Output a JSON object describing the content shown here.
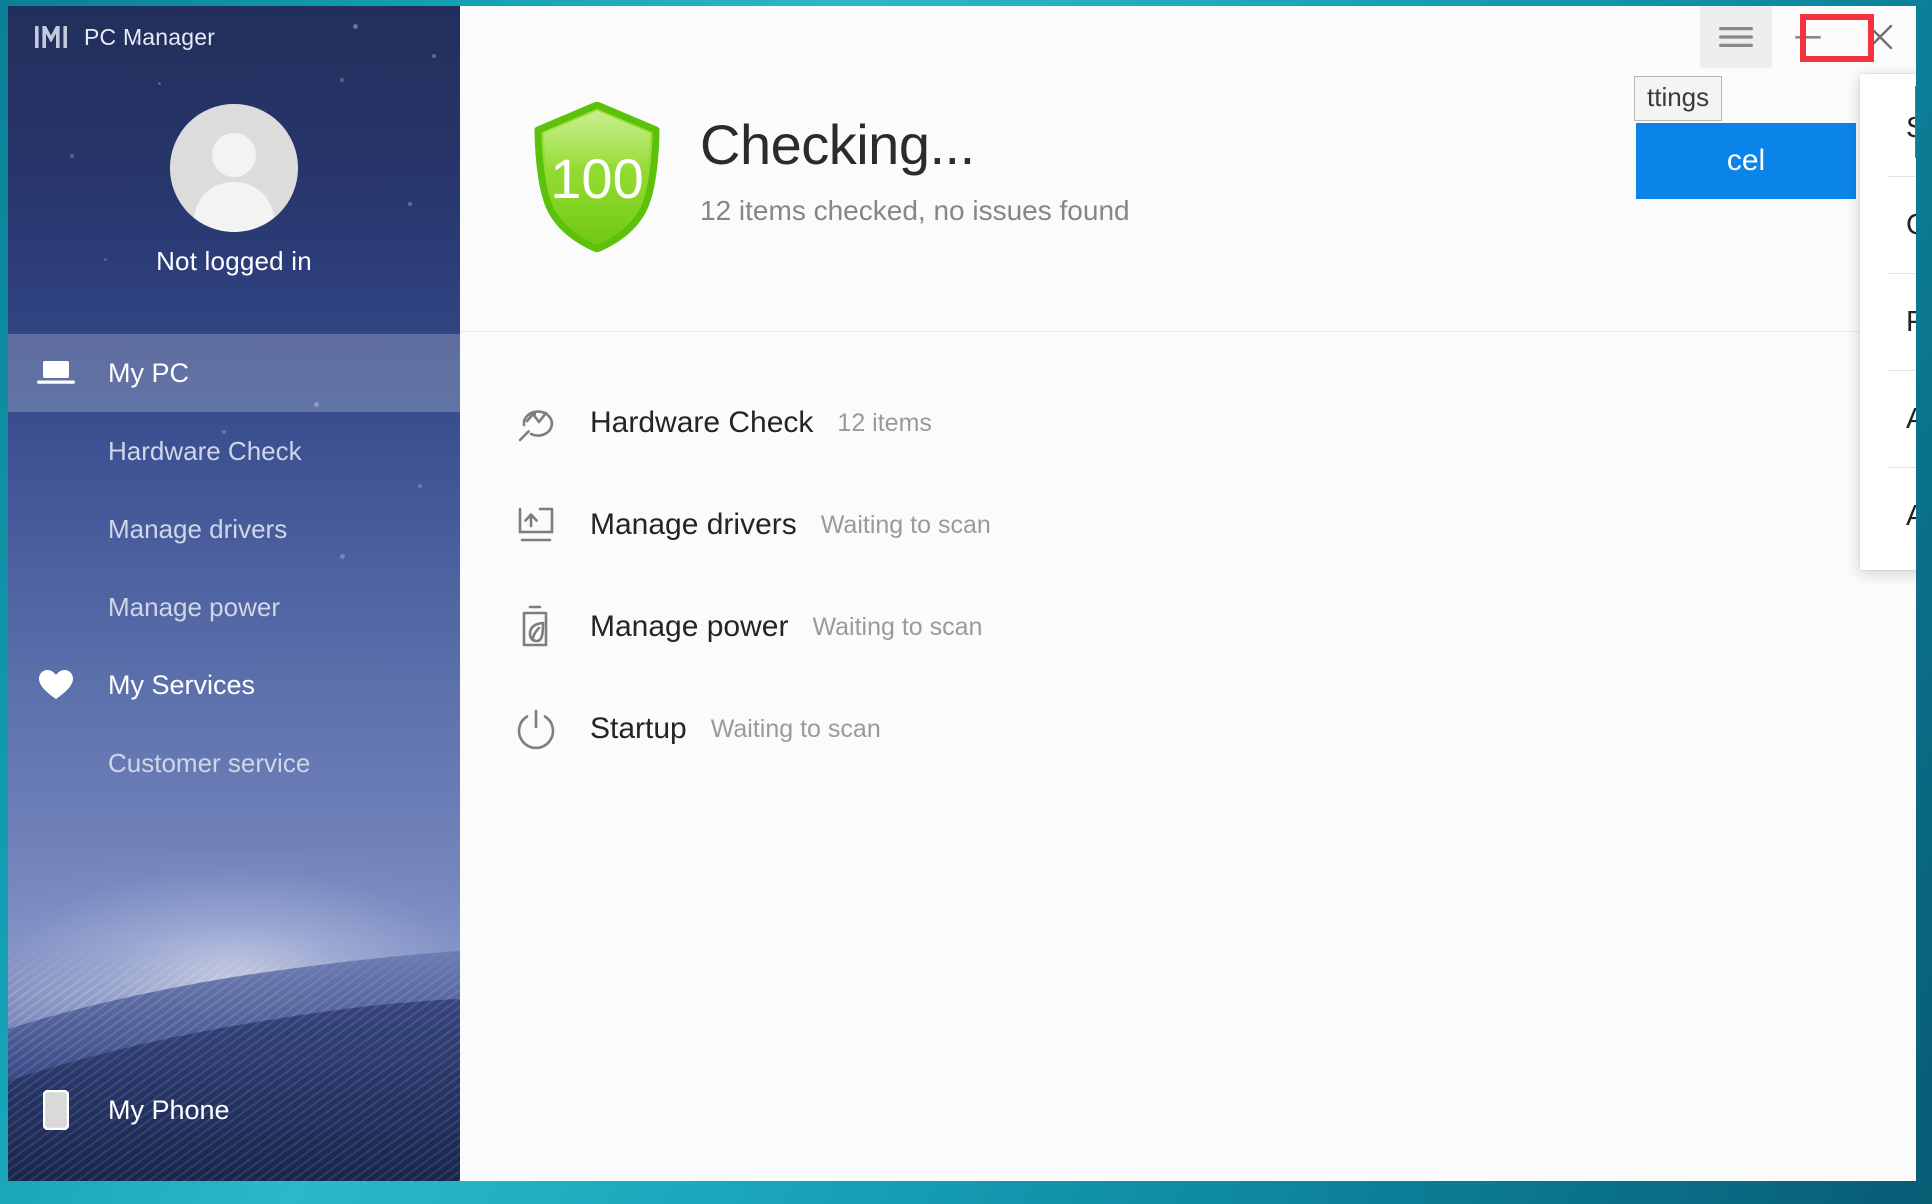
{
  "window": {
    "app_title": "PC Manager",
    "logo_icon": "pcmanager-logo-icon",
    "controls": [
      {
        "name": "menu-button",
        "icon": "hamburger-menu-icon",
        "label": "Menu",
        "highlighted": true
      },
      {
        "name": "minimize-button",
        "icon": "minimize-icon",
        "label": "Minimize"
      },
      {
        "name": "close-button",
        "icon": "close-icon",
        "label": "Close"
      }
    ]
  },
  "sidebar": {
    "account": {
      "avatar_icon": "user-avatar-icon",
      "name": "Not logged in"
    },
    "items": [
      {
        "label": "My PC",
        "icon": "laptop-icon",
        "active": true,
        "sub": false
      },
      {
        "label": "Hardware Check",
        "icon": "",
        "active": false,
        "sub": true
      },
      {
        "label": "Manage drivers",
        "icon": "",
        "active": false,
        "sub": true
      },
      {
        "label": "Manage power",
        "icon": "",
        "active": false,
        "sub": true
      },
      {
        "label": "My Services",
        "icon": "heart-icon",
        "active": false,
        "sub": false
      },
      {
        "label": "Customer service",
        "icon": "",
        "active": false,
        "sub": true
      }
    ],
    "bottom_item": {
      "label": "My Phone",
      "icon": "phone-icon"
    }
  },
  "main": {
    "status": {
      "score": "100",
      "score_color": "#7bd322",
      "shield_icon": "shield-score-icon",
      "title": "Checking...",
      "subtitle": "12 items checked, no issues found"
    },
    "scan_rows": [
      {
        "label": "Hardware Check",
        "status": "12 items",
        "icon": "hardware-scan-icon"
      },
      {
        "label": "Manage drivers",
        "status": "Waiting to scan",
        "icon": "driver-update-icon"
      },
      {
        "label": "Manage power",
        "status": "Waiting to scan",
        "icon": "battery-leaf-icon"
      },
      {
        "label": "Startup",
        "status": "Waiting to scan",
        "icon": "power-icon"
      }
    ]
  },
  "dropdown": {
    "items": [
      {
        "label": "Settings",
        "highlighted": true,
        "separator_after": true
      },
      {
        "label": "Check for updates",
        "highlighted": false,
        "separator_after": true
      },
      {
        "label": "Feedback",
        "highlighted": false,
        "separator_after": true
      },
      {
        "label": "App notice",
        "highlighted": false,
        "separator_after": true
      },
      {
        "label": "About",
        "highlighted": false,
        "separator_after": false
      }
    ]
  },
  "background_dialog": {
    "tooltip_text": "ttings",
    "cancel_label": "cel"
  },
  "annotations": {
    "highlight_color": "#f5333f",
    "boxes": [
      {
        "target": "menu-button"
      },
      {
        "target": "settings-menu-item"
      }
    ]
  }
}
